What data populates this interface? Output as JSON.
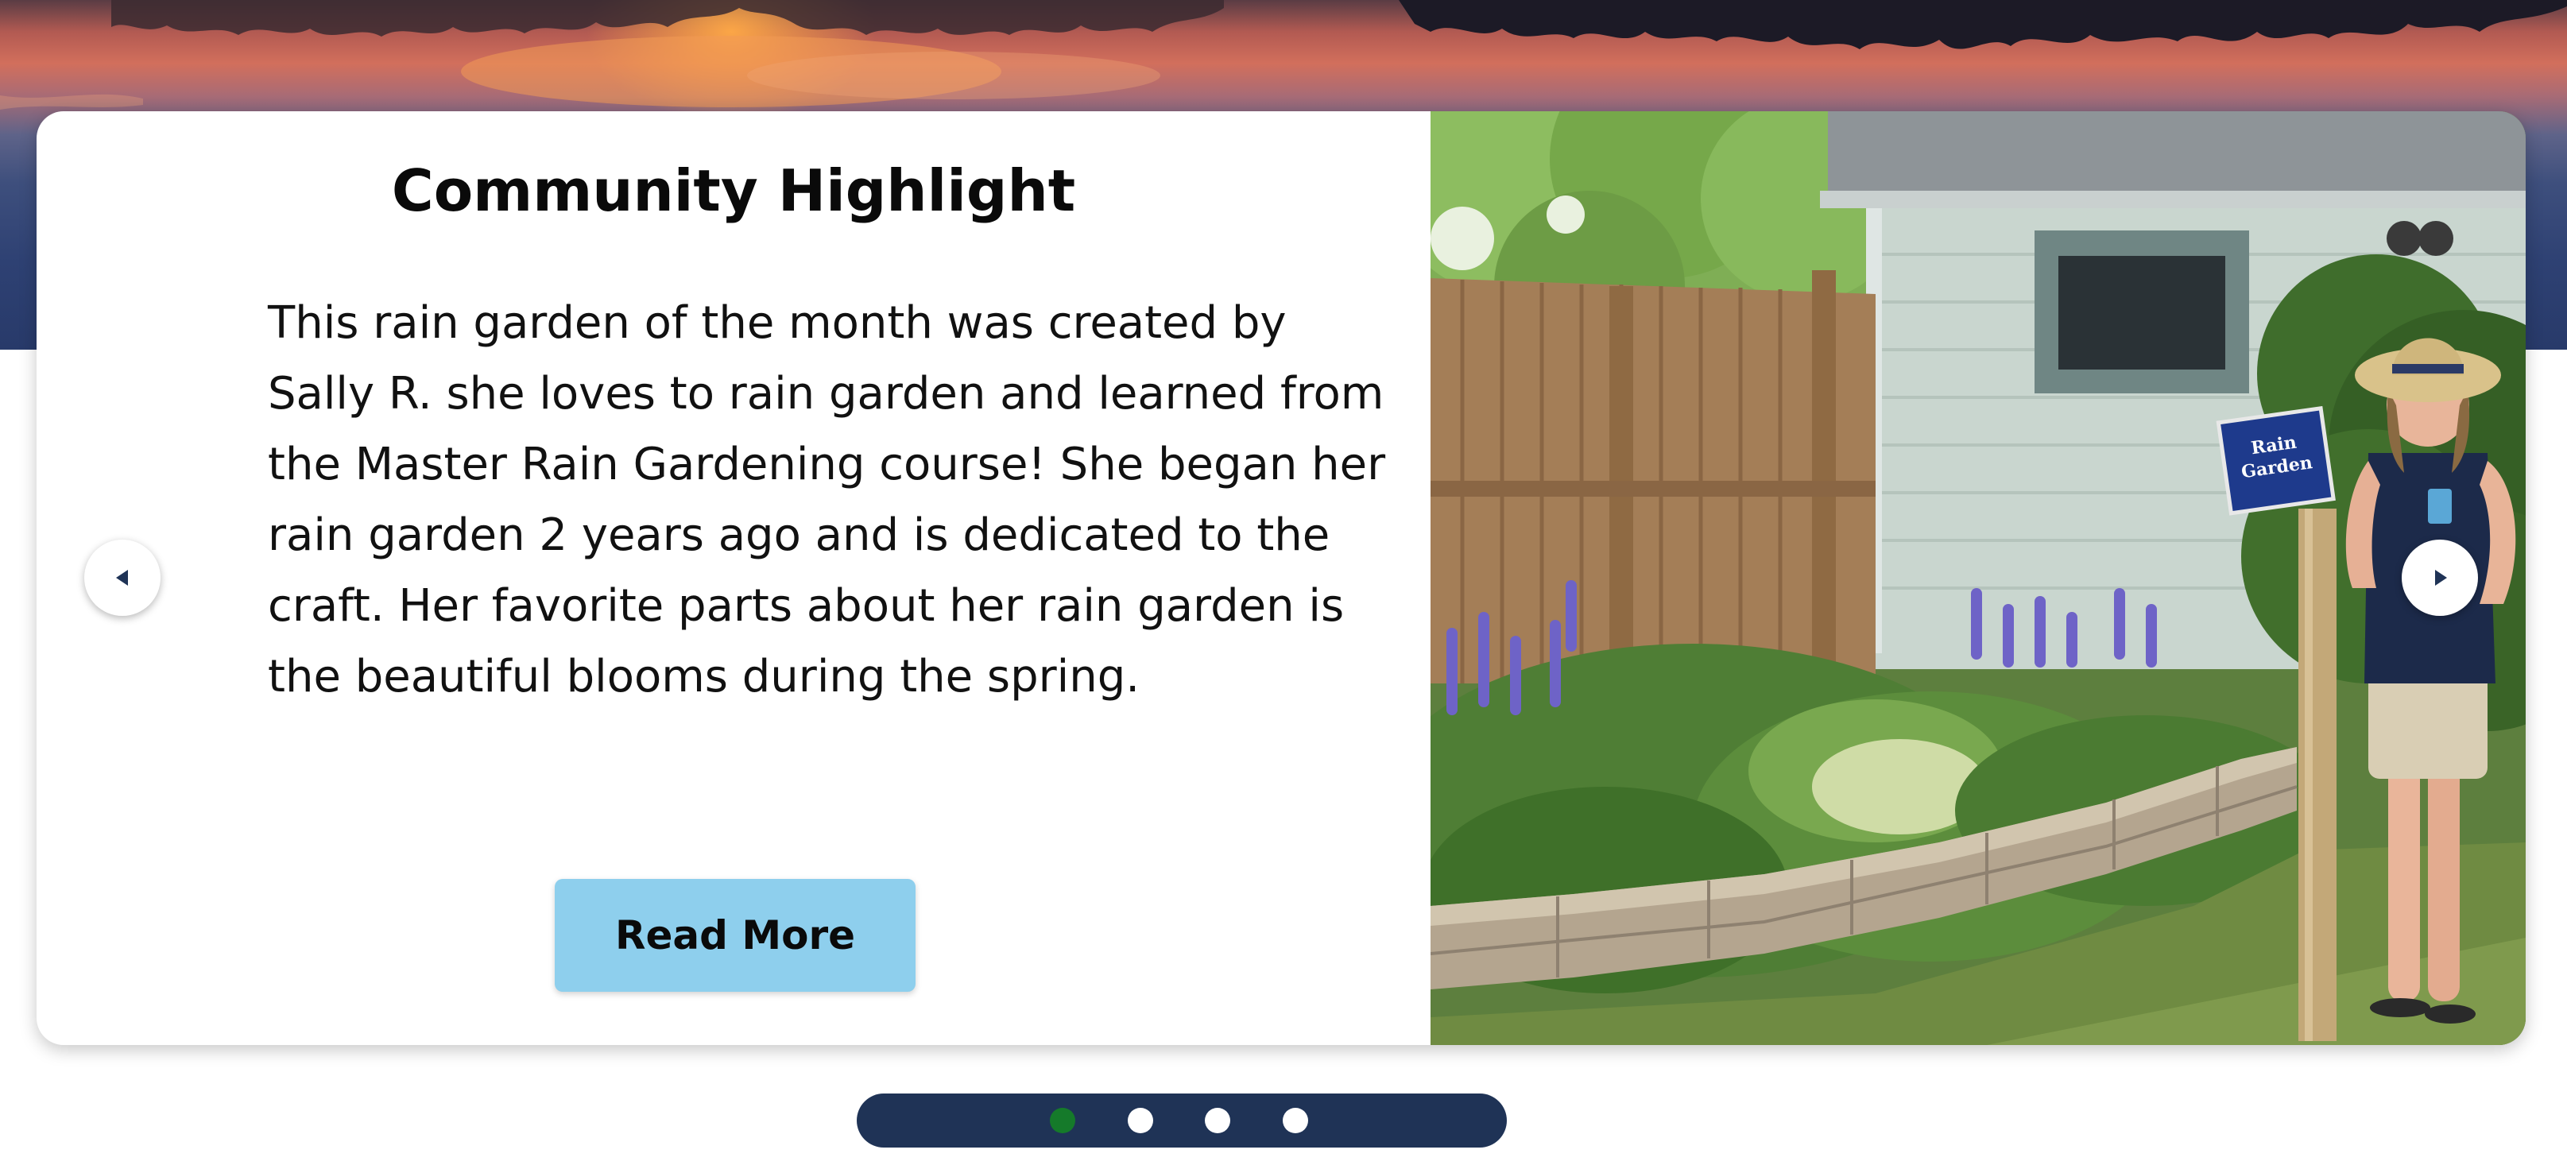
{
  "highlight": {
    "title": "Community Highlight",
    "body": "This rain garden of the month was created by Sally R. she loves to rain garden and learned from the Master Rain Gardening course! She began her rain garden 2 years ago and is dedicated to the craft. Her favorite parts about her rain garden is the beautiful blooms during the spring.",
    "read_more_label": "Read More"
  },
  "photo": {
    "sign_line_1": "Rain",
    "sign_line_2": "Garden"
  },
  "carousel": {
    "slide_count": 4,
    "active_index": 0
  },
  "colors": {
    "button": "#8ecfed",
    "pager": "#1f3356",
    "active_dot": "#157a2a",
    "inactive_dot": "#ffffff"
  },
  "icons": {
    "prev": "caret-left-icon",
    "next": "caret-right-icon"
  }
}
